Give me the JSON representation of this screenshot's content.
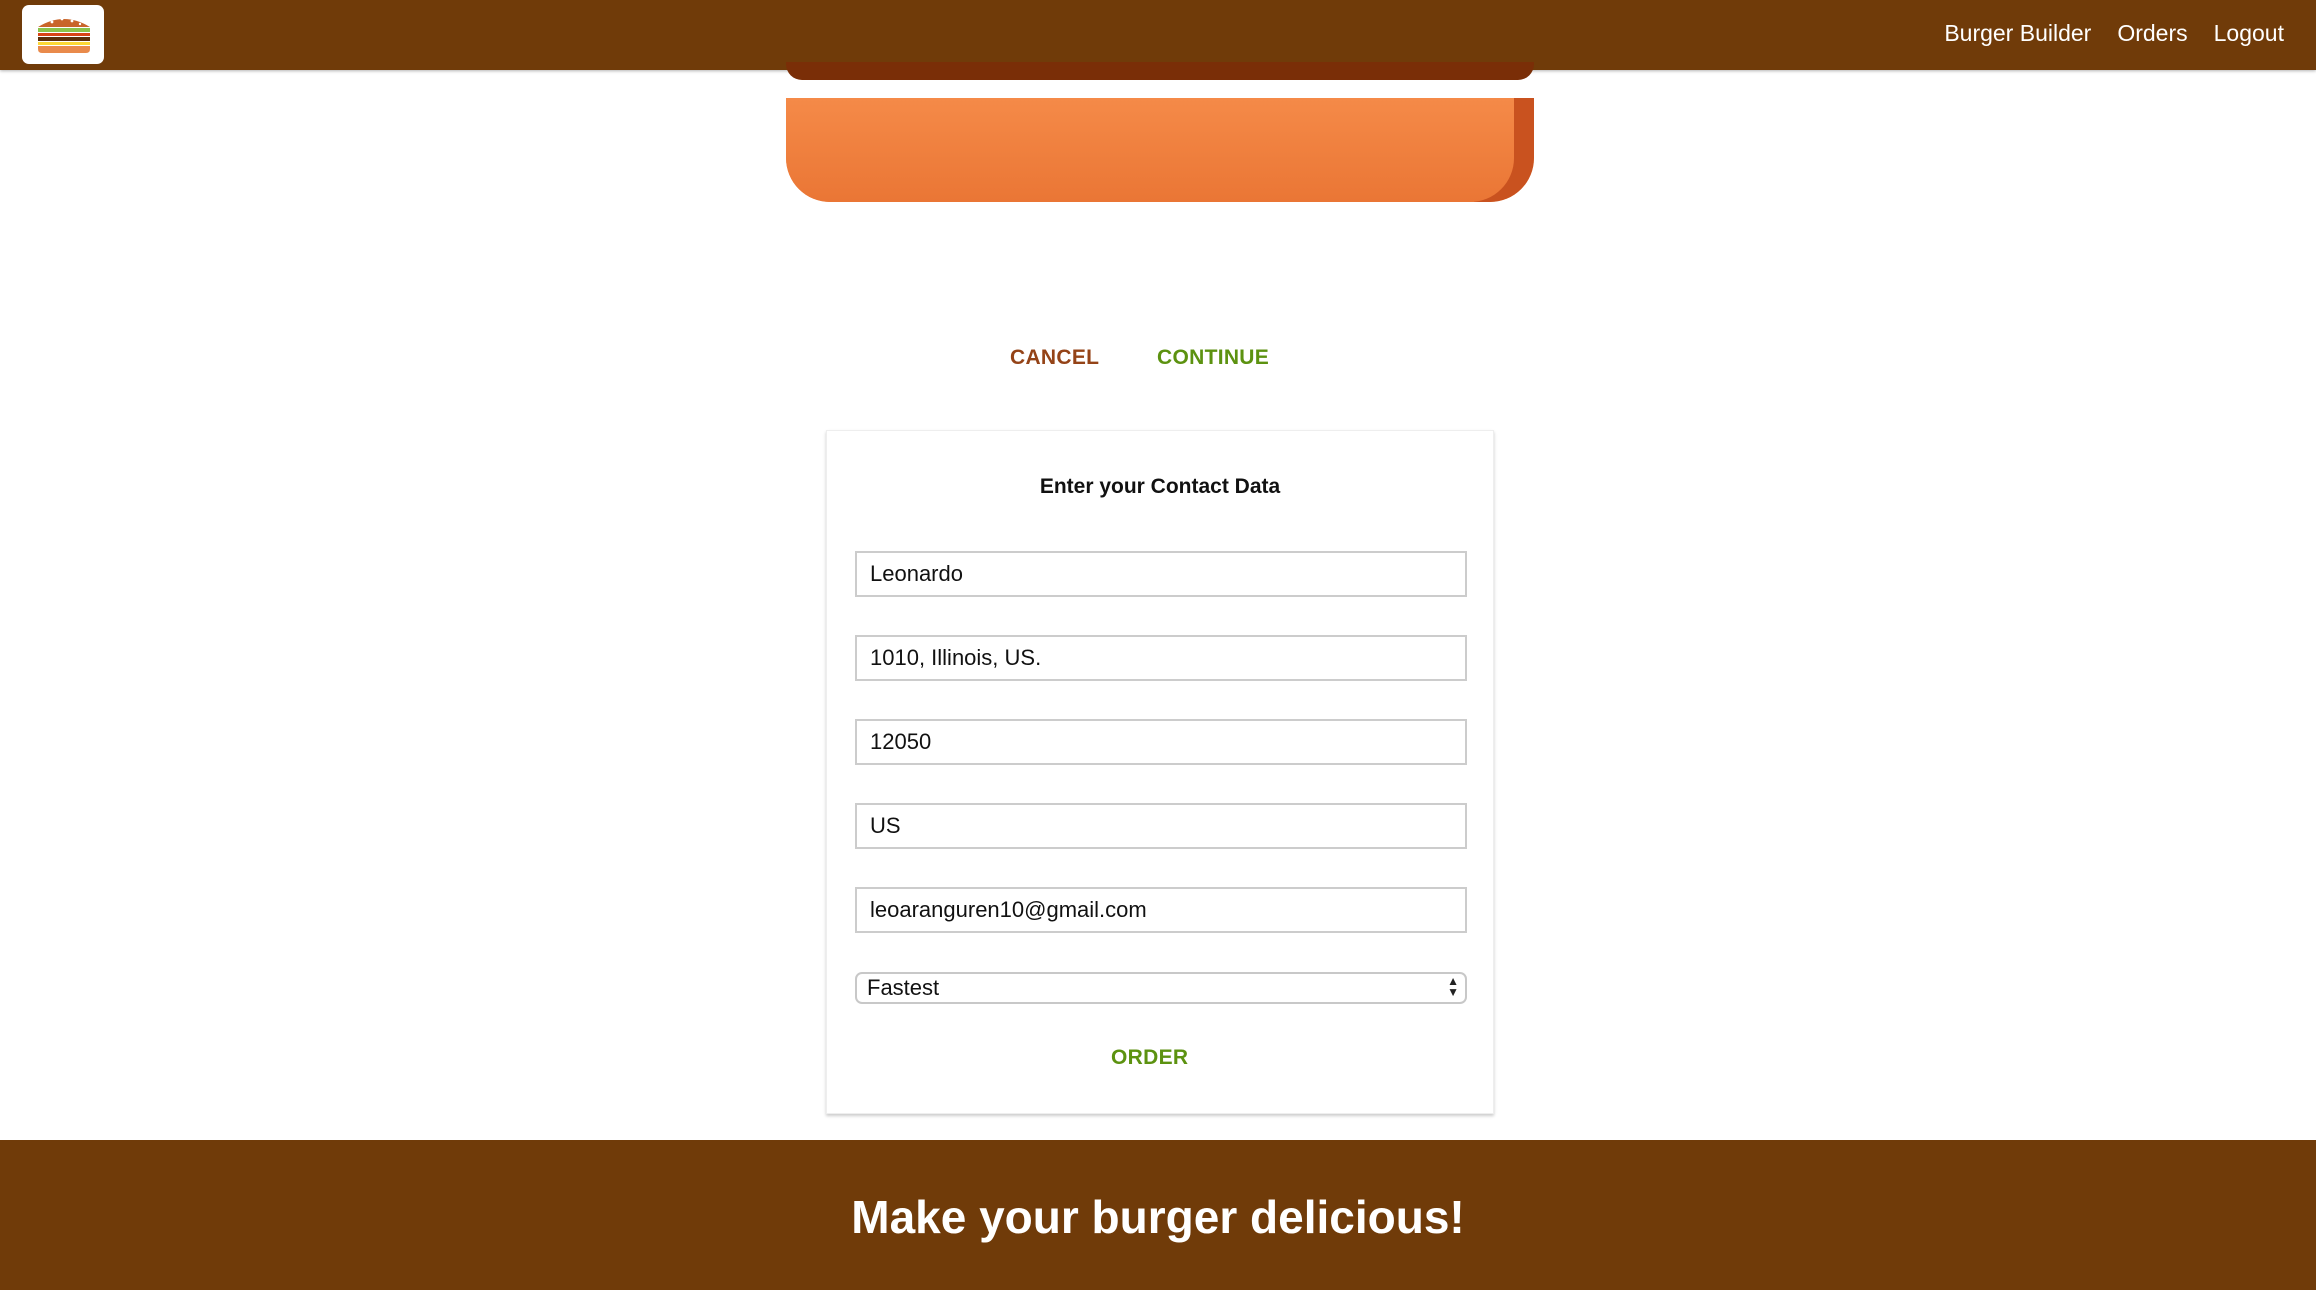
{
  "nav": {
    "items": [
      {
        "label": "Burger Builder"
      },
      {
        "label": "Orders"
      },
      {
        "label": "Logout"
      }
    ]
  },
  "modal": {
    "cancel_label": "CANCEL",
    "continue_label": "CONTINUE"
  },
  "contact": {
    "title": "Enter your Contact Data",
    "fields": {
      "name": "Leonardo",
      "street": "1010, Illinois, US.",
      "zip": "12050",
      "country": "US",
      "email": "leoaranguren10@gmail.com"
    },
    "delivery": {
      "selected": "Fastest"
    },
    "order_label": "ORDER"
  },
  "footer": {
    "tagline": "Make your burger delicious!"
  },
  "colors": {
    "toolbar": "#703b09",
    "cancel": "#944317",
    "success": "#5c9210",
    "bread": "#e97634"
  },
  "icons": {
    "logo": "burger-logo-icon",
    "select": "select-arrows-icon"
  }
}
